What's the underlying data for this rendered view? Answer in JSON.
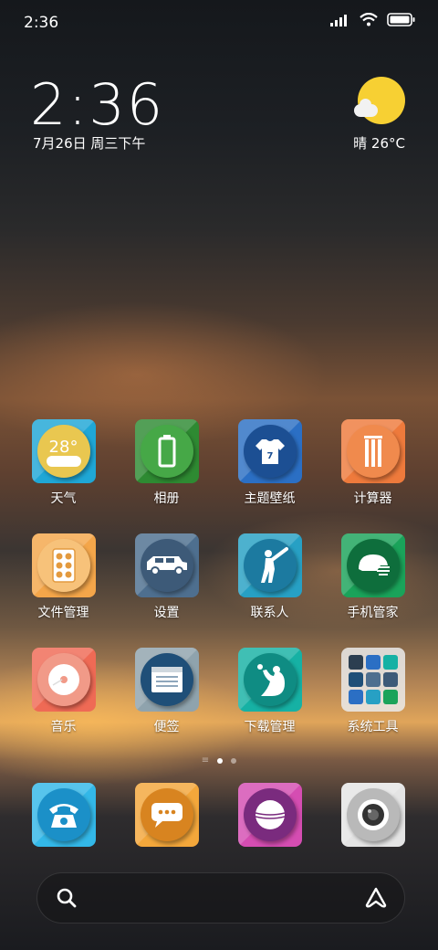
{
  "status": {
    "time": "2:36"
  },
  "clock": {
    "time": "2:36",
    "date": "7月26日 周三下午"
  },
  "weather": {
    "text": "晴 26°C"
  },
  "apps": [
    {
      "id": "weather",
      "label": "天气",
      "bg": "#1fa7d6",
      "circle": "#e9c750",
      "icon": "28°"
    },
    {
      "id": "gallery",
      "label": "相册",
      "bg": "#2e8a32",
      "circle": "#46a847",
      "icon": "battery"
    },
    {
      "id": "themes",
      "label": "主题壁纸",
      "bg": "#2b6fc4",
      "circle": "#1c4f93",
      "icon": "jersey"
    },
    {
      "id": "calculator",
      "label": "计算器",
      "bg": "#ee7a3c",
      "circle": "#f08a4d",
      "icon": "stumps"
    },
    {
      "id": "files",
      "label": "文件管理",
      "bg": "#f4a64a",
      "circle": "#f7c27a",
      "icon": "pills"
    },
    {
      "id": "settings",
      "label": "设置",
      "bg": "#4e6f8f",
      "circle": "#3d5a78",
      "icon": "car"
    },
    {
      "id": "contacts",
      "label": "联系人",
      "bg": "#27a0c4",
      "circle": "#1c7aa0",
      "icon": "batsman"
    },
    {
      "id": "security",
      "label": "手机管家",
      "bg": "#1aa35a",
      "circle": "#0e6e3c",
      "icon": "helmet"
    },
    {
      "id": "music",
      "label": "音乐",
      "bg": "#ef6a55",
      "circle": "#f19a88",
      "icon": "disc"
    },
    {
      "id": "notes",
      "label": "便签",
      "bg": "#8fa3ad",
      "circle": "#1f4f78",
      "icon": "note"
    },
    {
      "id": "downloads",
      "label": "下载管理",
      "bg": "#16b1a4",
      "circle": "#0f8c83",
      "icon": "catch"
    },
    {
      "id": "tools",
      "label": "系统工具",
      "bg": "#e9e9e9",
      "circle": "",
      "icon": "folder"
    }
  ],
  "dock": [
    {
      "id": "phone",
      "bg": "#33b8e8",
      "circle": "#1b90c8",
      "icon": "phone"
    },
    {
      "id": "messages",
      "bg": "#f3a73b",
      "circle": "#d88420",
      "icon": "chat"
    },
    {
      "id": "browser",
      "bg": "#d54db2",
      "circle": "#7a2b7e",
      "icon": "ball"
    },
    {
      "id": "camera",
      "bg": "#e4e4e4",
      "circle": "#b9b9b9",
      "icon": "lens"
    }
  ],
  "pages": {
    "current": 1,
    "total": 2
  }
}
